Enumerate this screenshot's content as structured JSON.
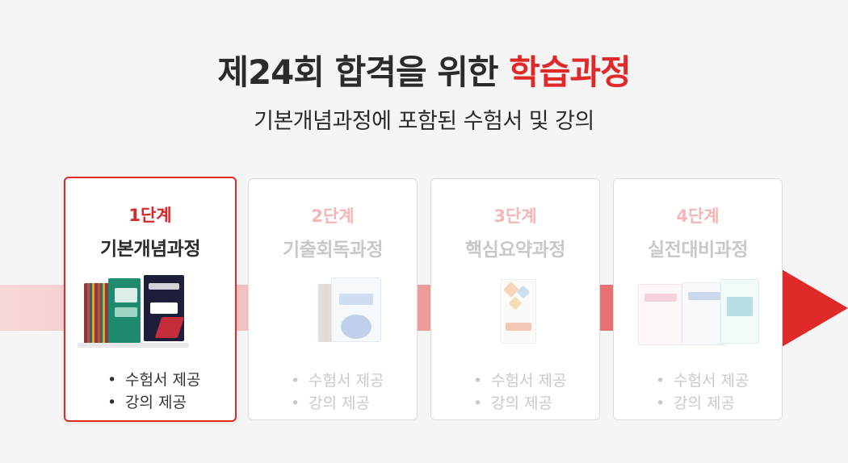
{
  "header": {
    "headline_prefix": "제24회 합격을 위한 ",
    "headline_accent": "학습과정",
    "subline": "기본개념과정에 포함된 수험서 및 강의"
  },
  "colors": {
    "accent": "#e02a2a",
    "text_dark": "#2b2b2b",
    "inactive_text": "#c8c8c8",
    "inactive_step": "#f4b6b6"
  },
  "steps": [
    {
      "step": "1단계",
      "title": "기본개념과정",
      "items": [
        "수험서 제공",
        "강의 제공"
      ],
      "active": true,
      "image": "book-set-basic-concepts"
    },
    {
      "step": "2단계",
      "title": "기출회독과정",
      "items": [
        "수험서 제공",
        "강의 제공"
      ],
      "active": false,
      "image": "book-set-past-exams"
    },
    {
      "step": "3단계",
      "title": "핵심요약과정",
      "items": [
        "수험서 제공",
        "강의 제공"
      ],
      "active": false,
      "image": "book-core-summary"
    },
    {
      "step": "4단계",
      "title": "실전대비과정",
      "items": [
        "수험서 제공",
        "강의 제공"
      ],
      "active": false,
      "image": "book-set-final-prep"
    }
  ],
  "bullet": "•",
  "icons": {
    "flow_arrow": "arrow-right-icon"
  }
}
